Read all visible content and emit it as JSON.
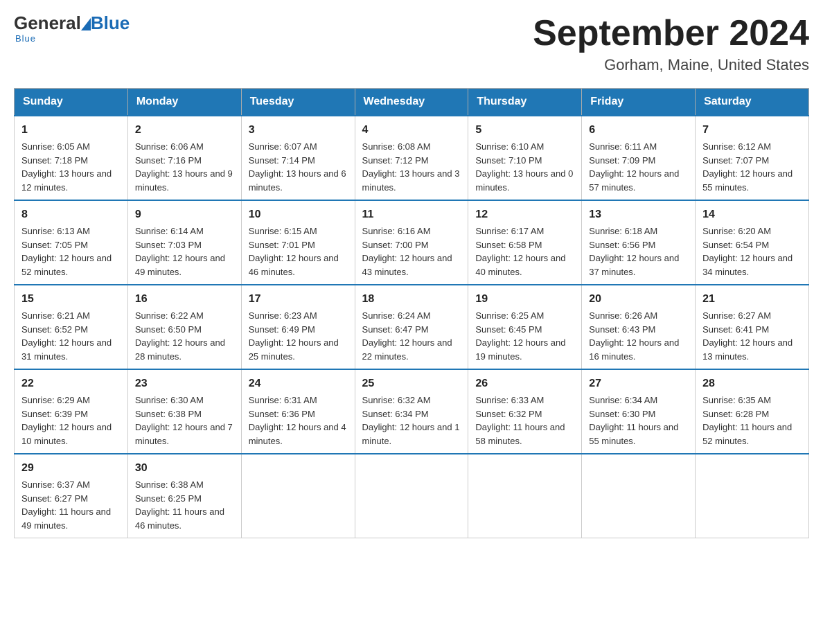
{
  "header": {
    "logo_general": "General",
    "logo_blue": "Blue",
    "logo_underline": "Blue",
    "month_title": "September 2024",
    "location": "Gorham, Maine, United States"
  },
  "days_of_week": [
    "Sunday",
    "Monday",
    "Tuesday",
    "Wednesday",
    "Thursday",
    "Friday",
    "Saturday"
  ],
  "weeks": [
    [
      {
        "day": "1",
        "sunrise": "Sunrise: 6:05 AM",
        "sunset": "Sunset: 7:18 PM",
        "daylight": "Daylight: 13 hours and 12 minutes."
      },
      {
        "day": "2",
        "sunrise": "Sunrise: 6:06 AM",
        "sunset": "Sunset: 7:16 PM",
        "daylight": "Daylight: 13 hours and 9 minutes."
      },
      {
        "day": "3",
        "sunrise": "Sunrise: 6:07 AM",
        "sunset": "Sunset: 7:14 PM",
        "daylight": "Daylight: 13 hours and 6 minutes."
      },
      {
        "day": "4",
        "sunrise": "Sunrise: 6:08 AM",
        "sunset": "Sunset: 7:12 PM",
        "daylight": "Daylight: 13 hours and 3 minutes."
      },
      {
        "day": "5",
        "sunrise": "Sunrise: 6:10 AM",
        "sunset": "Sunset: 7:10 PM",
        "daylight": "Daylight: 13 hours and 0 minutes."
      },
      {
        "day": "6",
        "sunrise": "Sunrise: 6:11 AM",
        "sunset": "Sunset: 7:09 PM",
        "daylight": "Daylight: 12 hours and 57 minutes."
      },
      {
        "day": "7",
        "sunrise": "Sunrise: 6:12 AM",
        "sunset": "Sunset: 7:07 PM",
        "daylight": "Daylight: 12 hours and 55 minutes."
      }
    ],
    [
      {
        "day": "8",
        "sunrise": "Sunrise: 6:13 AM",
        "sunset": "Sunset: 7:05 PM",
        "daylight": "Daylight: 12 hours and 52 minutes."
      },
      {
        "day": "9",
        "sunrise": "Sunrise: 6:14 AM",
        "sunset": "Sunset: 7:03 PM",
        "daylight": "Daylight: 12 hours and 49 minutes."
      },
      {
        "day": "10",
        "sunrise": "Sunrise: 6:15 AM",
        "sunset": "Sunset: 7:01 PM",
        "daylight": "Daylight: 12 hours and 46 minutes."
      },
      {
        "day": "11",
        "sunrise": "Sunrise: 6:16 AM",
        "sunset": "Sunset: 7:00 PM",
        "daylight": "Daylight: 12 hours and 43 minutes."
      },
      {
        "day": "12",
        "sunrise": "Sunrise: 6:17 AM",
        "sunset": "Sunset: 6:58 PM",
        "daylight": "Daylight: 12 hours and 40 minutes."
      },
      {
        "day": "13",
        "sunrise": "Sunrise: 6:18 AM",
        "sunset": "Sunset: 6:56 PM",
        "daylight": "Daylight: 12 hours and 37 minutes."
      },
      {
        "day": "14",
        "sunrise": "Sunrise: 6:20 AM",
        "sunset": "Sunset: 6:54 PM",
        "daylight": "Daylight: 12 hours and 34 minutes."
      }
    ],
    [
      {
        "day": "15",
        "sunrise": "Sunrise: 6:21 AM",
        "sunset": "Sunset: 6:52 PM",
        "daylight": "Daylight: 12 hours and 31 minutes."
      },
      {
        "day": "16",
        "sunrise": "Sunrise: 6:22 AM",
        "sunset": "Sunset: 6:50 PM",
        "daylight": "Daylight: 12 hours and 28 minutes."
      },
      {
        "day": "17",
        "sunrise": "Sunrise: 6:23 AM",
        "sunset": "Sunset: 6:49 PM",
        "daylight": "Daylight: 12 hours and 25 minutes."
      },
      {
        "day": "18",
        "sunrise": "Sunrise: 6:24 AM",
        "sunset": "Sunset: 6:47 PM",
        "daylight": "Daylight: 12 hours and 22 minutes."
      },
      {
        "day": "19",
        "sunrise": "Sunrise: 6:25 AM",
        "sunset": "Sunset: 6:45 PM",
        "daylight": "Daylight: 12 hours and 19 minutes."
      },
      {
        "day": "20",
        "sunrise": "Sunrise: 6:26 AM",
        "sunset": "Sunset: 6:43 PM",
        "daylight": "Daylight: 12 hours and 16 minutes."
      },
      {
        "day": "21",
        "sunrise": "Sunrise: 6:27 AM",
        "sunset": "Sunset: 6:41 PM",
        "daylight": "Daylight: 12 hours and 13 minutes."
      }
    ],
    [
      {
        "day": "22",
        "sunrise": "Sunrise: 6:29 AM",
        "sunset": "Sunset: 6:39 PM",
        "daylight": "Daylight: 12 hours and 10 minutes."
      },
      {
        "day": "23",
        "sunrise": "Sunrise: 6:30 AM",
        "sunset": "Sunset: 6:38 PM",
        "daylight": "Daylight: 12 hours and 7 minutes."
      },
      {
        "day": "24",
        "sunrise": "Sunrise: 6:31 AM",
        "sunset": "Sunset: 6:36 PM",
        "daylight": "Daylight: 12 hours and 4 minutes."
      },
      {
        "day": "25",
        "sunrise": "Sunrise: 6:32 AM",
        "sunset": "Sunset: 6:34 PM",
        "daylight": "Daylight: 12 hours and 1 minute."
      },
      {
        "day": "26",
        "sunrise": "Sunrise: 6:33 AM",
        "sunset": "Sunset: 6:32 PM",
        "daylight": "Daylight: 11 hours and 58 minutes."
      },
      {
        "day": "27",
        "sunrise": "Sunrise: 6:34 AM",
        "sunset": "Sunset: 6:30 PM",
        "daylight": "Daylight: 11 hours and 55 minutes."
      },
      {
        "day": "28",
        "sunrise": "Sunrise: 6:35 AM",
        "sunset": "Sunset: 6:28 PM",
        "daylight": "Daylight: 11 hours and 52 minutes."
      }
    ],
    [
      {
        "day": "29",
        "sunrise": "Sunrise: 6:37 AM",
        "sunset": "Sunset: 6:27 PM",
        "daylight": "Daylight: 11 hours and 49 minutes."
      },
      {
        "day": "30",
        "sunrise": "Sunrise: 6:38 AM",
        "sunset": "Sunset: 6:25 PM",
        "daylight": "Daylight: 11 hours and 46 minutes."
      },
      null,
      null,
      null,
      null,
      null
    ]
  ]
}
